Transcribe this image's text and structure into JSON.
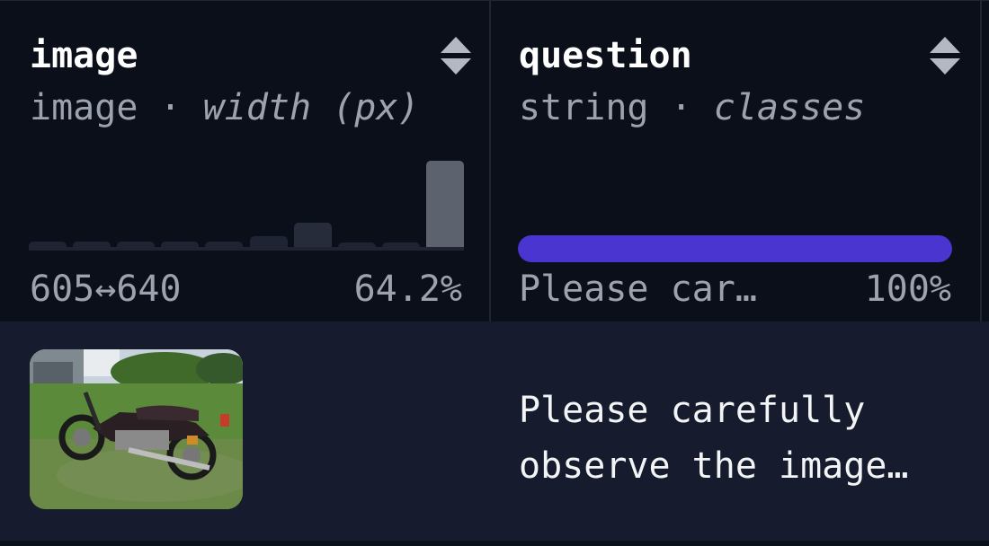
{
  "columns": [
    {
      "name": "image",
      "dtype": "image",
      "stat_label": "width (px)",
      "range_label": "605↔640",
      "percent_label": "64.2%",
      "histogram": [
        0.06,
        0.06,
        0.06,
        0.06,
        0.06,
        0.13,
        0.28,
        0.05,
        0.05,
        1.0
      ]
    },
    {
      "name": "question",
      "dtype": "string",
      "stat_label": "classes",
      "top_value_label": "Please car…",
      "percent_label": "100%",
      "fill_fraction": 1.0
    }
  ],
  "rows": [
    {
      "image_alt": "motorcycle on grass",
      "question": "Please carefully\nobserve the image…"
    }
  ],
  "colors": {
    "accent": "#4b35d1",
    "header_bg": "#0b0f1a",
    "row_bg": "#161c2d"
  },
  "icons": {
    "sort": "sort-icon"
  }
}
